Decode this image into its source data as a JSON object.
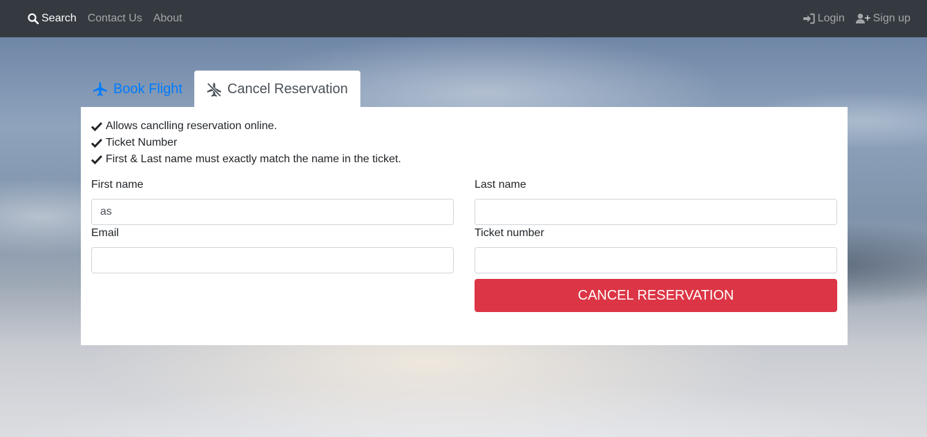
{
  "navbar": {
    "items": [
      {
        "label": "Search",
        "icon": "search-icon",
        "active": true
      },
      {
        "label": "Contact Us"
      },
      {
        "label": "About"
      }
    ],
    "right": [
      {
        "label": "Login",
        "icon": "sign-in-icon"
      },
      {
        "label": "Sign up",
        "icon": "user-plus-icon"
      }
    ]
  },
  "tabs": [
    {
      "label": "Book Flight",
      "icon": "plane-icon",
      "active": false
    },
    {
      "label": "Cancel Reservation",
      "icon": "plane-slash-icon",
      "active": true
    }
  ],
  "notes": [
    "Allows canclling reservation online.",
    "Ticket Number",
    "First & Last name must exactly match the name in the ticket."
  ],
  "form": {
    "first_name": {
      "label": "First name",
      "value": "as"
    },
    "last_name": {
      "label": "Last name",
      "value": ""
    },
    "email": {
      "label": "Email",
      "value": ""
    },
    "ticket_number": {
      "label": "Ticket number",
      "value": ""
    },
    "submit_label": "CANCEL RESERVATION"
  },
  "colors": {
    "navbar": "#343a40",
    "link_primary": "#007bff",
    "danger": "#dc3545"
  }
}
